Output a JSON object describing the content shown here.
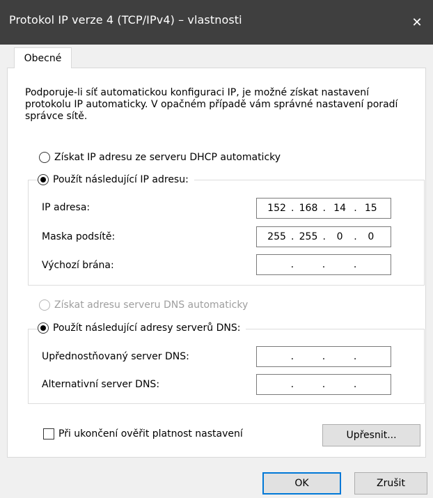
{
  "window": {
    "title": "Protokol IP verze 4 (TCP/IPv4) – vlastnosti",
    "close_glyph": "✕"
  },
  "tabs": [
    {
      "label": "Obecné"
    }
  ],
  "intro_text": "Podporuje-li síť automatickou konfiguraci IP, je možné získat nastavení protokolu IP automaticky. V opačném případě vám správné nastavení poradí správce sítě.",
  "ip": {
    "auto_label": "Získat IP adresu ze serveru DHCP automaticky",
    "manual_label": "Použít následující IP adresu:",
    "selected": "manual",
    "fields": {
      "ip_address": {
        "label": "IP adresa:",
        "octets": [
          "152",
          "168",
          "14",
          "15"
        ]
      },
      "subnet_mask": {
        "label": "Maska podsítě:",
        "octets": [
          "255",
          "255",
          "0",
          "0"
        ]
      },
      "gateway": {
        "label": "Výchozí brána:",
        "octets": [
          "",
          "",
          "",
          ""
        ]
      }
    }
  },
  "dns": {
    "auto_label": "Získat adresu serveru DNS automaticky",
    "manual_label": "Použít následující adresy serverů DNS:",
    "selected": "manual",
    "fields": {
      "preferred": {
        "label": "Upřednostňovaný server DNS:",
        "octets": [
          "",
          "",
          "",
          ""
        ]
      },
      "alternate": {
        "label": "Alternativní server DNS:",
        "octets": [
          "",
          "",
          "",
          ""
        ]
      }
    }
  },
  "validate_checkbox": {
    "label": "Při ukončení ověřit platnost nastavení",
    "checked": false
  },
  "buttons": {
    "advanced": "Upřesnit...",
    "ok": "OK",
    "cancel": "Zrušit"
  },
  "colors": {
    "titlebar": "#3f3f3f",
    "focus_border": "#0078d7"
  }
}
